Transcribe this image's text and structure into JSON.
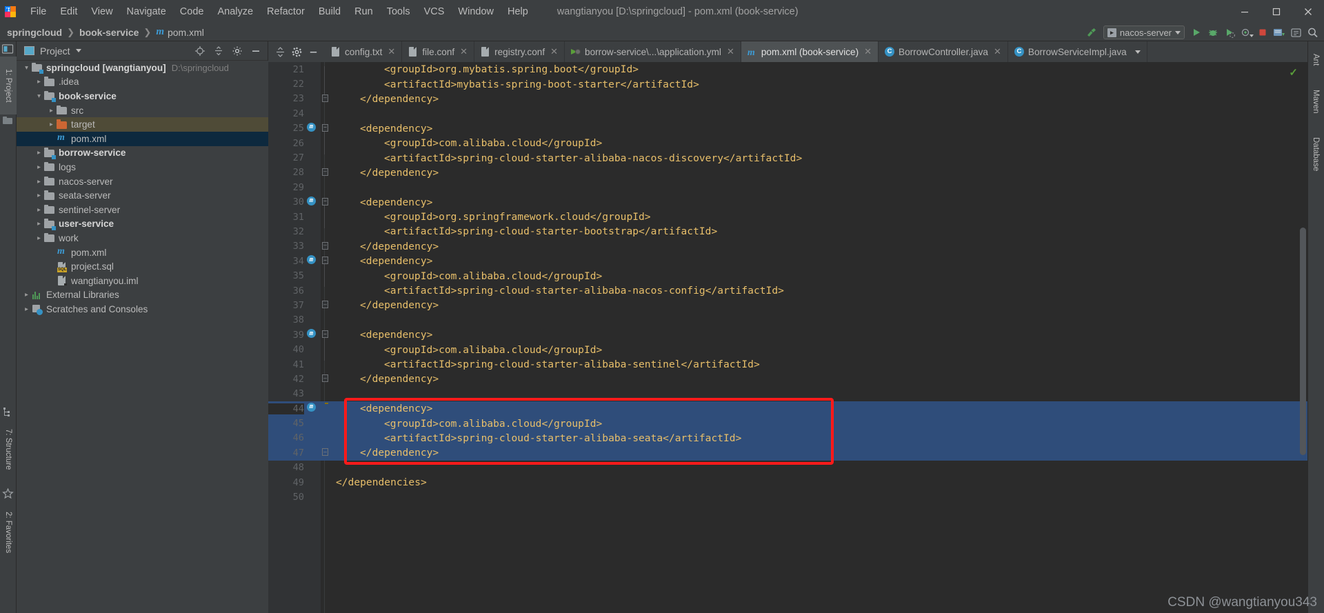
{
  "window": {
    "title": "wangtianyou [D:\\springcloud] - pom.xml (book-service)",
    "logo_icon": "intellij-idea-logo-icon",
    "minimize_label": "—",
    "maximize_label": "❐",
    "close_label": "✕"
  },
  "menubar": {
    "items": [
      {
        "label": "File"
      },
      {
        "label": "Edit"
      },
      {
        "label": "View"
      },
      {
        "label": "Navigate"
      },
      {
        "label": "Code"
      },
      {
        "label": "Analyze"
      },
      {
        "label": "Refactor"
      },
      {
        "label": "Build"
      },
      {
        "label": "Run"
      },
      {
        "label": "Tools"
      },
      {
        "label": "VCS"
      },
      {
        "label": "Window"
      },
      {
        "label": "Help"
      }
    ]
  },
  "navbar": {
    "breadcrumbs": [
      {
        "label": "springcloud",
        "bold": true
      },
      {
        "label": "book-service",
        "bold": true
      },
      {
        "label": "pom.xml",
        "bold": false,
        "icon": "maven-m-icon"
      }
    ],
    "separator": "❯",
    "run_config": {
      "label": "nacos-server",
      "icon": "run-config-app-icon",
      "dropdown_icon": "chevron-down-icon"
    },
    "actions": [
      {
        "name": "build-hammer-icon"
      },
      {
        "name": "run-icon"
      },
      {
        "name": "debug-icon"
      },
      {
        "name": "run-with-coverage-icon"
      },
      {
        "name": "profiler-icon"
      },
      {
        "name": "stop-icon"
      },
      {
        "name": "update-project-icon"
      },
      {
        "name": "settings-icon"
      },
      {
        "name": "search-everywhere-icon"
      }
    ]
  },
  "left_stripe": {
    "items": [
      {
        "label": "1: Project",
        "icon": "project-tool-icon",
        "selected": true
      },
      {
        "label": "2: Favorites",
        "icon": "favorites-icon",
        "selected": false
      },
      {
        "label": "7: Structure",
        "icon": "structure-icon",
        "selected": false
      }
    ]
  },
  "right_stripe": {
    "items": [
      {
        "label": "Ant",
        "icon": "ant-icon"
      },
      {
        "label": "Maven",
        "icon": "maven-icon"
      },
      {
        "label": "Database",
        "icon": "database-icon"
      }
    ]
  },
  "project_panel": {
    "title": "Project",
    "title_dropdown_icon": "chevron-down-icon",
    "header_actions": [
      {
        "name": "scroll-from-source-icon"
      },
      {
        "name": "collapse-all-icon"
      },
      {
        "name": "settings-gear-icon"
      },
      {
        "name": "hide-panel-icon"
      }
    ],
    "tree": [
      {
        "depth": 0,
        "arrow": "expanded",
        "icon": "module-folder-icon",
        "label": "springcloud [wangtianyou]",
        "bold": true,
        "path": "D:\\springcloud",
        "state": "normal"
      },
      {
        "depth": 1,
        "arrow": "collapsed",
        "icon": "folder-icon",
        "label": ".idea",
        "bold": false,
        "state": "normal"
      },
      {
        "depth": 1,
        "arrow": "expanded",
        "icon": "module-folder-icon",
        "label": "book-service",
        "bold": true,
        "state": "normal"
      },
      {
        "depth": 2,
        "arrow": "collapsed",
        "icon": "folder-icon",
        "label": "src",
        "bold": false,
        "state": "normal"
      },
      {
        "depth": 2,
        "arrow": "collapsed",
        "icon": "folder-excluded-icon",
        "label": "target",
        "bold": false,
        "state": "excluded"
      },
      {
        "depth": 2,
        "arrow": "none",
        "icon": "maven-m-icon",
        "label": "pom.xml",
        "bold": false,
        "state": "selected"
      },
      {
        "depth": 1,
        "arrow": "collapsed",
        "icon": "module-folder-icon",
        "label": "borrow-service",
        "bold": true,
        "state": "normal"
      },
      {
        "depth": 1,
        "arrow": "collapsed",
        "icon": "folder-icon",
        "label": "logs",
        "bold": false,
        "state": "normal"
      },
      {
        "depth": 1,
        "arrow": "collapsed",
        "icon": "folder-icon",
        "label": "nacos-server",
        "bold": false,
        "state": "normal"
      },
      {
        "depth": 1,
        "arrow": "collapsed",
        "icon": "folder-icon",
        "label": "seata-server",
        "bold": false,
        "state": "normal"
      },
      {
        "depth": 1,
        "arrow": "collapsed",
        "icon": "folder-icon",
        "label": "sentinel-server",
        "bold": false,
        "state": "normal"
      },
      {
        "depth": 1,
        "arrow": "collapsed",
        "icon": "module-folder-icon",
        "label": "user-service",
        "bold": true,
        "state": "normal"
      },
      {
        "depth": 1,
        "arrow": "collapsed",
        "icon": "folder-icon",
        "label": "work",
        "bold": false,
        "state": "normal"
      },
      {
        "depth": 1,
        "arrow": "none",
        "icon": "maven-m-icon",
        "label": "pom.xml",
        "bold": false,
        "state": "normal"
      },
      {
        "depth": 1,
        "arrow": "none",
        "icon": "sql-file-icon",
        "label": "project.sql",
        "bold": false,
        "state": "normal"
      },
      {
        "depth": 1,
        "arrow": "none",
        "icon": "iml-file-icon",
        "label": "wangtianyou.iml",
        "bold": false,
        "state": "normal"
      },
      {
        "depth": 0,
        "arrow": "collapsed",
        "icon": "external-libraries-icon",
        "label": "External Libraries",
        "bold": false,
        "state": "normal"
      },
      {
        "depth": 0,
        "arrow": "collapsed",
        "icon": "scratches-icon",
        "label": "Scratches and Consoles",
        "bold": false,
        "state": "normal"
      }
    ]
  },
  "editor": {
    "tools": [
      {
        "name": "expand-all-icon"
      },
      {
        "name": "settings-gear-icon"
      },
      {
        "name": "hide-panel-icon"
      }
    ],
    "tabs": [
      {
        "label": "config.txt",
        "icon": "text-file-icon",
        "active": false,
        "closable": true
      },
      {
        "label": "file.conf",
        "icon": "text-file-icon",
        "active": false,
        "closable": true
      },
      {
        "label": "registry.conf",
        "icon": "text-file-icon",
        "active": false,
        "closable": true
      },
      {
        "label": "borrow-service\\...\\application.yml",
        "icon": "spring-yaml-icon",
        "active": false,
        "closable": true
      },
      {
        "label": "pom.xml (book-service)",
        "icon": "maven-m-icon",
        "active": true,
        "closable": true
      },
      {
        "label": "BorrowController.java",
        "icon": "java-class-icon",
        "active": false,
        "closable": true
      },
      {
        "label": "BorrowServiceImpl.java",
        "icon": "java-class-icon",
        "active": false,
        "closable": false
      }
    ],
    "tabs_overflow_icon": "chevron-down-icon",
    "inspection_status_icon": "inspections-ok-check-icon",
    "code_lines": [
      {
        "num": 21,
        "indent": 12,
        "text": "<groupId>org.mybatis.spring.boot</groupId>",
        "gutter_icon": null,
        "fold": null
      },
      {
        "num": 22,
        "indent": 12,
        "text": "<artifactId>mybatis-spring-boot-starter</artifactId>",
        "gutter_icon": null,
        "fold": null
      },
      {
        "num": 23,
        "indent": 8,
        "text": "</dependency>",
        "gutter_icon": null,
        "fold": "end"
      },
      {
        "num": 24,
        "indent": 0,
        "text": "",
        "gutter_icon": null,
        "fold": null
      },
      {
        "num": 25,
        "indent": 8,
        "text": "<dependency>",
        "gutter_icon": "maven-dependency-icon",
        "fold": "start"
      },
      {
        "num": 26,
        "indent": 12,
        "text": "<groupId>com.alibaba.cloud</groupId>",
        "gutter_icon": null,
        "fold": null
      },
      {
        "num": 27,
        "indent": 12,
        "text": "<artifactId>spring-cloud-starter-alibaba-nacos-discovery</artifactId>",
        "gutter_icon": null,
        "fold": null
      },
      {
        "num": 28,
        "indent": 8,
        "text": "</dependency>",
        "gutter_icon": null,
        "fold": "end"
      },
      {
        "num": 29,
        "indent": 0,
        "text": "",
        "gutter_icon": null,
        "fold": null
      },
      {
        "num": 30,
        "indent": 8,
        "text": "<dependency>",
        "gutter_icon": "maven-dependency-icon",
        "fold": "start"
      },
      {
        "num": 31,
        "indent": 12,
        "text": "<groupId>org.springframework.cloud</groupId>",
        "gutter_icon": null,
        "fold": null
      },
      {
        "num": 32,
        "indent": 12,
        "text": "<artifactId>spring-cloud-starter-bootstrap</artifactId>",
        "gutter_icon": null,
        "fold": null
      },
      {
        "num": 33,
        "indent": 8,
        "text": "</dependency>",
        "gutter_icon": null,
        "fold": "end"
      },
      {
        "num": 34,
        "indent": 8,
        "text": "<dependency>",
        "gutter_icon": "maven-dependency-icon",
        "fold": "start"
      },
      {
        "num": 35,
        "indent": 12,
        "text": "<groupId>com.alibaba.cloud</groupId>",
        "gutter_icon": null,
        "fold": null
      },
      {
        "num": 36,
        "indent": 12,
        "text": "<artifactId>spring-cloud-starter-alibaba-nacos-config</artifactId>",
        "gutter_icon": null,
        "fold": null
      },
      {
        "num": 37,
        "indent": 8,
        "text": "</dependency>",
        "gutter_icon": null,
        "fold": "end"
      },
      {
        "num": 38,
        "indent": 0,
        "text": "",
        "gutter_icon": null,
        "fold": null
      },
      {
        "num": 39,
        "indent": 8,
        "text": "<dependency>",
        "gutter_icon": "maven-dependency-icon",
        "fold": "start"
      },
      {
        "num": 40,
        "indent": 12,
        "text": "<groupId>com.alibaba.cloud</groupId>",
        "gutter_icon": null,
        "fold": null
      },
      {
        "num": 41,
        "indent": 12,
        "text": "<artifactId>spring-cloud-starter-alibaba-sentinel</artifactId>",
        "gutter_icon": null,
        "fold": null
      },
      {
        "num": 42,
        "indent": 8,
        "text": "</dependency>",
        "gutter_icon": null,
        "fold": "end"
      },
      {
        "num": 43,
        "indent": 0,
        "text": "",
        "gutter_icon": null,
        "fold": null
      },
      {
        "num": 44,
        "indent": 8,
        "text": "<dependency>",
        "gutter_icon": "maven-dependency-icon",
        "fold": "start",
        "hint_icon": "intention-bulb-icon",
        "selected": true
      },
      {
        "num": 45,
        "indent": 12,
        "text": "<groupId>com.alibaba.cloud</groupId>",
        "gutter_icon": null,
        "fold": null,
        "selected": true
      },
      {
        "num": 46,
        "indent": 12,
        "text": "<artifactId>spring-cloud-starter-alibaba-seata</artifactId>",
        "gutter_icon": null,
        "fold": null,
        "selected": true
      },
      {
        "num": 47,
        "indent": 8,
        "text": "</dependency>",
        "gutter_icon": null,
        "fold": "end",
        "selected": true
      },
      {
        "num": 48,
        "indent": 0,
        "text": "",
        "gutter_icon": null,
        "fold": null
      },
      {
        "num": 49,
        "indent": 4,
        "text": "</dependencies>",
        "gutter_icon": null,
        "fold": "end"
      },
      {
        "num": 50,
        "indent": 0,
        "text": "",
        "gutter_icon": null,
        "fold": null
      }
    ]
  },
  "annotation": {
    "highlight_color": "#ff1a1a",
    "highlight_lines": "44-47"
  },
  "watermark": {
    "text": "CSDN @wangtianyou343"
  },
  "colors": {
    "background": "#3c3f41",
    "editor_background": "#2b2b2b",
    "gutter_background": "#313335",
    "selection_blue": "#2f4d7a",
    "tag_orange": "#e8bf6a",
    "text_gray": "#a9b7c6",
    "accent_blue": "#3592c4",
    "tree_selected": "#0d293e",
    "excluded_olive": "#4f4b37"
  }
}
